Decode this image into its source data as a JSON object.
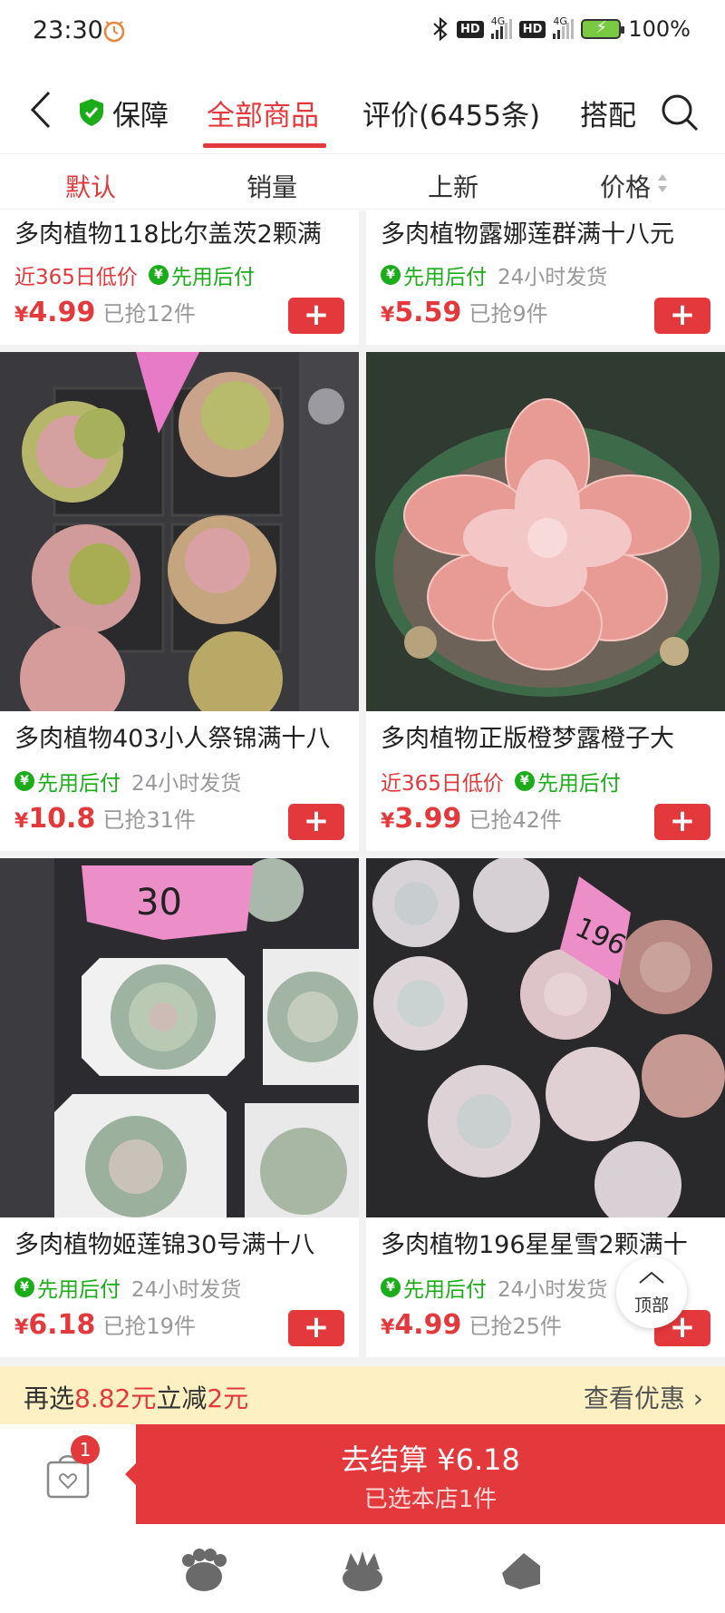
{
  "status_bar": {
    "time": "23:30",
    "network_badges": [
      "HD",
      "HD"
    ],
    "network_type": "4G",
    "battery": "100%"
  },
  "nav": {
    "guarantee": "保障",
    "tabs": [
      {
        "label": "全部商品",
        "active": true
      },
      {
        "label": "评价(6455条)",
        "active": false
      },
      {
        "label": "搭配",
        "active": false
      }
    ]
  },
  "sort": {
    "items": [
      {
        "label": "默认",
        "active": true
      },
      {
        "label": "销量",
        "active": false
      },
      {
        "label": "上新",
        "active": false
      },
      {
        "label": "价格",
        "active": false
      }
    ]
  },
  "products": [
    {
      "title": "多肉植物118比尔盖茨2颗满",
      "tags": {
        "low_price": "近365日低价",
        "pay_later": "先用后付",
        "shipping": ""
      },
      "yen": "¥",
      "price": "4.99",
      "sold": "已抢12件"
    },
    {
      "title": "多肉植物露娜莲群满十八元",
      "tags": {
        "low_price": "",
        "pay_later": "先用后付",
        "shipping": "24小时发货"
      },
      "yen": "¥",
      "price": "5.59",
      "sold": "已抢9件"
    },
    {
      "title": "多肉植物403小人祭锦满十八",
      "tags": {
        "low_price": "",
        "pay_later": "先用后付",
        "shipping": "24小时发货"
      },
      "yen": "¥",
      "price": "10.8",
      "sold": "已抢31件"
    },
    {
      "title": "多肉植物正版橙梦露橙子大",
      "tags": {
        "low_price": "近365日低价",
        "pay_later": "先用后付",
        "shipping": ""
      },
      "yen": "¥",
      "price": "3.99",
      "sold": "已抢42件"
    },
    {
      "title": "多肉植物姬莲锦30号满十八",
      "tags": {
        "low_price": "",
        "pay_later": "先用后付",
        "shipping": "24小时发货"
      },
      "yen": "¥",
      "price": "6.18",
      "sold": "已抢19件"
    },
    {
      "title": "多肉植物196星星雪2颗满十",
      "tags": {
        "low_price": "",
        "pay_later": "先用后付",
        "shipping": "24小时发货"
      },
      "yen": "¥",
      "price": "4.99",
      "sold": "已抢25件"
    }
  ],
  "plant_labels": {
    "tag_30": "30",
    "tag_196": "196"
  },
  "add_button": "+",
  "top_button": "顶部",
  "promo": {
    "prefix": "再选",
    "amount": "8.82元",
    "middle": "立减",
    "discount": "2元",
    "view_offers": "查看优惠 ›"
  },
  "checkout": {
    "cart_count": "1",
    "button_main": "去结算 ¥6.18",
    "button_sub": "已选本店1件"
  },
  "colors": {
    "accent": "#e4393c",
    "pay_green": "#1aad19",
    "promo_bg": "#fdf1c4"
  }
}
